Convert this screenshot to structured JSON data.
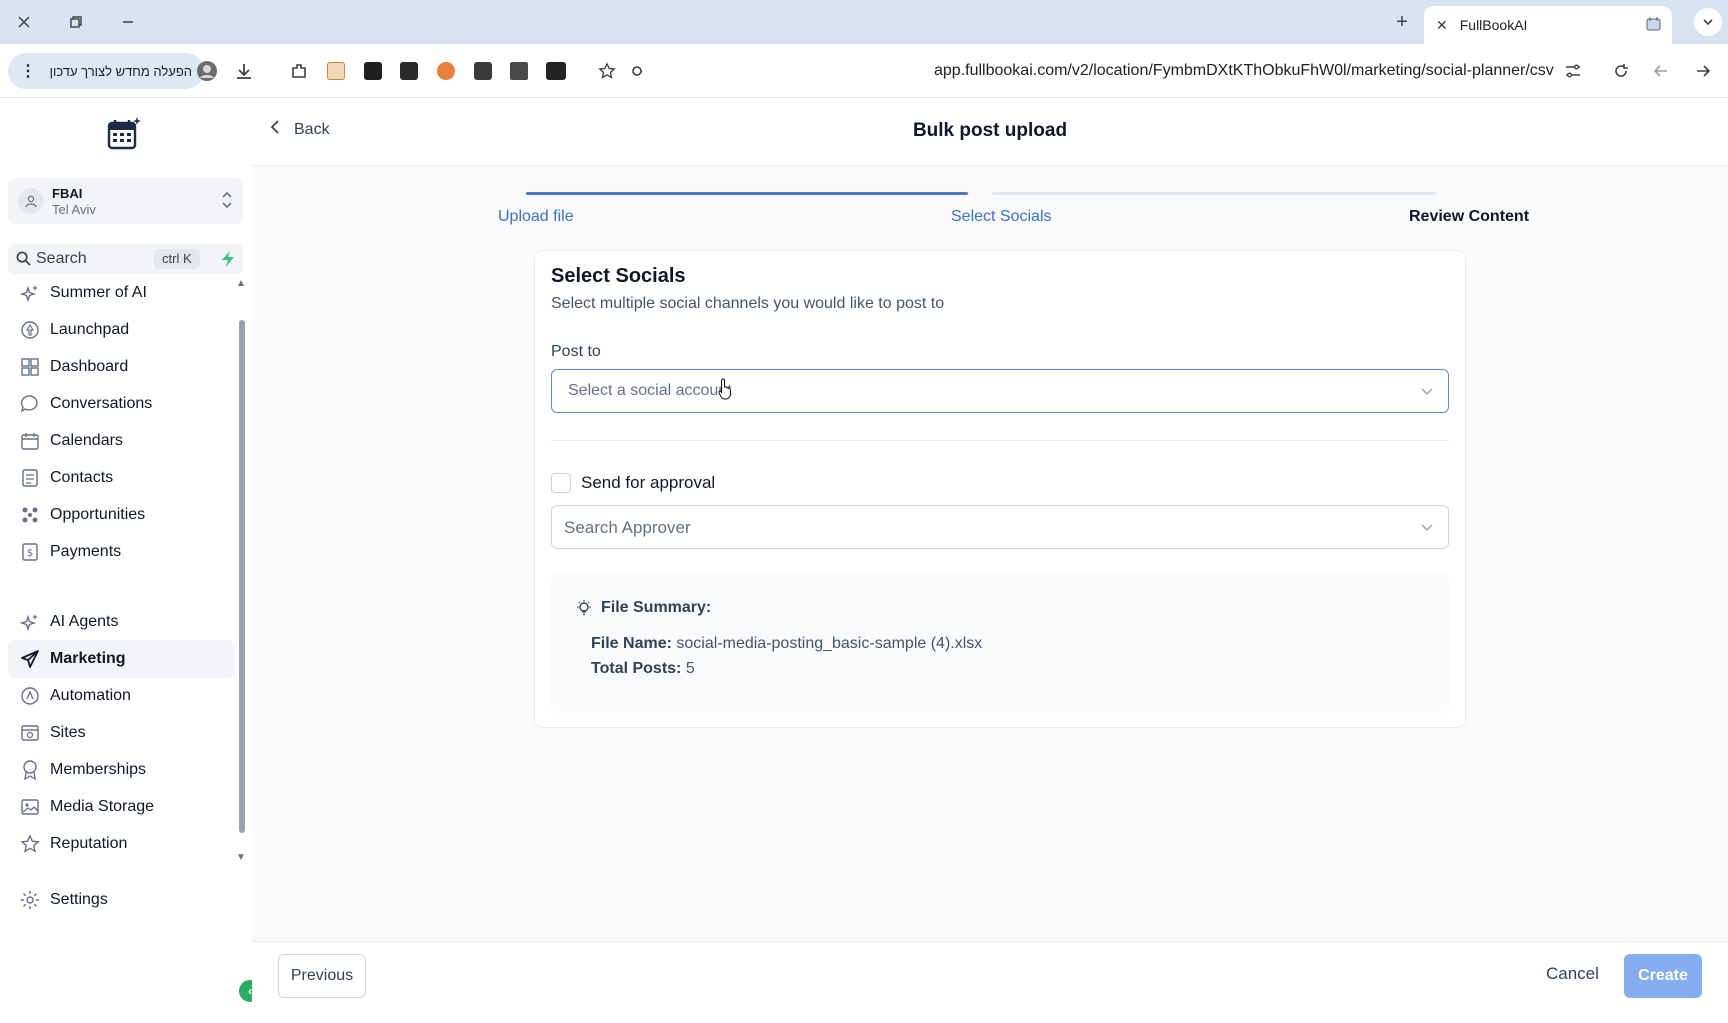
{
  "browser": {
    "tab_title": "FullBookAI",
    "url": "app.fullbookai.com/v2/location/FymbmDXtKThObkuFhW0l/marketing/social-planner/csv",
    "relaunch_label": "הפעלה מחדש לצורך עדכון"
  },
  "sidebar": {
    "account": {
      "name": "FBAI",
      "location": "Tel Aviv"
    },
    "search": {
      "label": "Search",
      "shortcut": "ctrl K"
    },
    "items": [
      {
        "label": "Summer of AI",
        "icon": "sparkle-icon"
      },
      {
        "label": "Launchpad",
        "icon": "rocket-icon"
      },
      {
        "label": "Dashboard",
        "icon": "grid-icon"
      },
      {
        "label": "Conversations",
        "icon": "chat-icon"
      },
      {
        "label": "Calendars",
        "icon": "calendar-icon"
      },
      {
        "label": "Contacts",
        "icon": "contacts-icon"
      },
      {
        "label": "Opportunities",
        "icon": "opportunities-icon"
      },
      {
        "label": "Payments",
        "icon": "payments-icon"
      },
      {
        "label": "AI Agents",
        "icon": "sparkle-icon"
      },
      {
        "label": "Marketing",
        "icon": "send-icon",
        "active": true
      },
      {
        "label": "Automation",
        "icon": "automation-icon"
      },
      {
        "label": "Sites",
        "icon": "sites-icon"
      },
      {
        "label": "Memberships",
        "icon": "membership-icon"
      },
      {
        "label": "Media Storage",
        "icon": "image-icon"
      },
      {
        "label": "Reputation",
        "icon": "star-icon"
      }
    ],
    "settings_label": "Settings"
  },
  "header": {
    "back_label": "Back",
    "title": "Bulk post upload"
  },
  "steps": [
    {
      "label": "Upload file",
      "state": "complete"
    },
    {
      "label": "Select Socials",
      "state": "current"
    },
    {
      "label": "Review Content",
      "state": "pending"
    }
  ],
  "form": {
    "title": "Select Socials",
    "subtitle": "Select multiple social channels you would like to post to",
    "post_to_label": "Post to",
    "post_to_placeholder": "Select a social account",
    "approval_label": "Send for approval",
    "approval_checked": false,
    "approver_placeholder": "Search Approver"
  },
  "summary": {
    "heading": "File Summary:",
    "file_name_label": "File Name:",
    "file_name": "social-media-posting_basic-sample (4).xlsx",
    "total_posts_label": "Total Posts:",
    "total_posts": "5"
  },
  "footer": {
    "previous_label": "Previous",
    "cancel_label": "Cancel",
    "create_label": "Create"
  },
  "colors": {
    "accent": "#3b6fd0",
    "step_active": "#4a78cf",
    "step_pending": "#e4e7ec",
    "create_disabled": "#84adf2"
  }
}
